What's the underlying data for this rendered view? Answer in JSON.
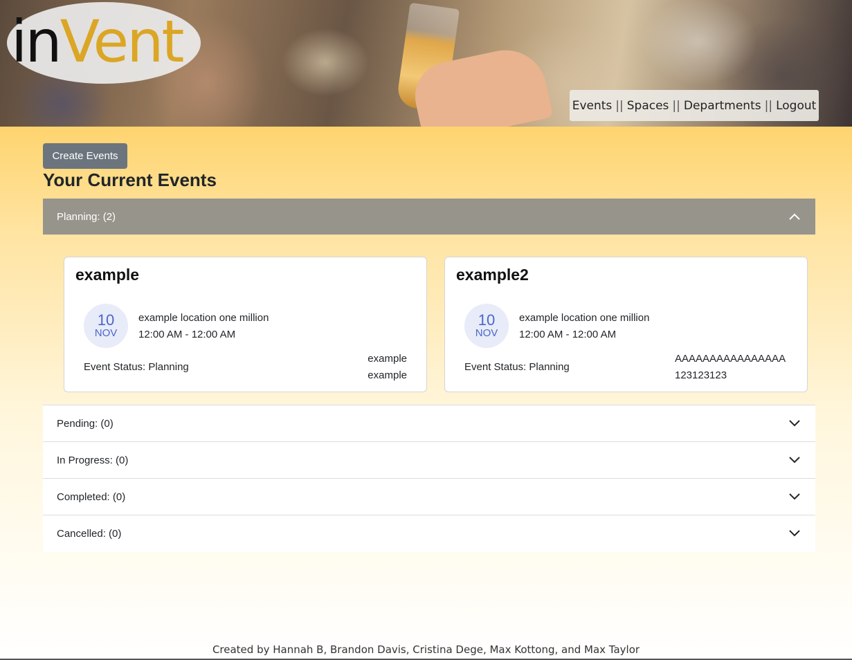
{
  "header": {
    "logo": {
      "part1": "in",
      "part2": "Vent"
    },
    "nav": [
      {
        "label": "Events"
      },
      {
        "label": "Spaces"
      },
      {
        "label": "Departments"
      },
      {
        "label": "Logout"
      }
    ],
    "nav_separator": "||"
  },
  "main": {
    "create_button": "Create Events",
    "title": "Your Current Events",
    "sections": [
      {
        "label": "Planning: (2)",
        "expanded": true,
        "events": [
          {
            "name": "example",
            "day": "10",
            "month": "NOV",
            "location": "example location one million",
            "time": "12:00 AM - 12:00 AM",
            "status": "Event Status: Planning",
            "extra_line1": "example",
            "extra_line2": "example"
          },
          {
            "name": "example2",
            "day": "10",
            "month": "NOV",
            "location": "example location one million",
            "time": "12:00 AM - 12:00 AM",
            "status": "Event Status: Planning",
            "extra_line1": "AAAAAAAAAAAAAAAA",
            "extra_line2": "123123123"
          }
        ]
      },
      {
        "label": "Pending: (0)",
        "expanded": false
      },
      {
        "label": "In Progress: (0)",
        "expanded": false
      },
      {
        "label": "Completed: (0)",
        "expanded": false
      },
      {
        "label": "Cancelled: (0)",
        "expanded": false
      }
    ]
  },
  "footer": {
    "credits": "Created by Hannah B, Brandon Davis, Cristina Dege, Max Kottong, and Max Taylor"
  },
  "colors": {
    "accent_gold": "#dba625",
    "panel_gray": "#97948c",
    "button_gray": "#6c757d",
    "date_blue": "#4a67c9"
  }
}
